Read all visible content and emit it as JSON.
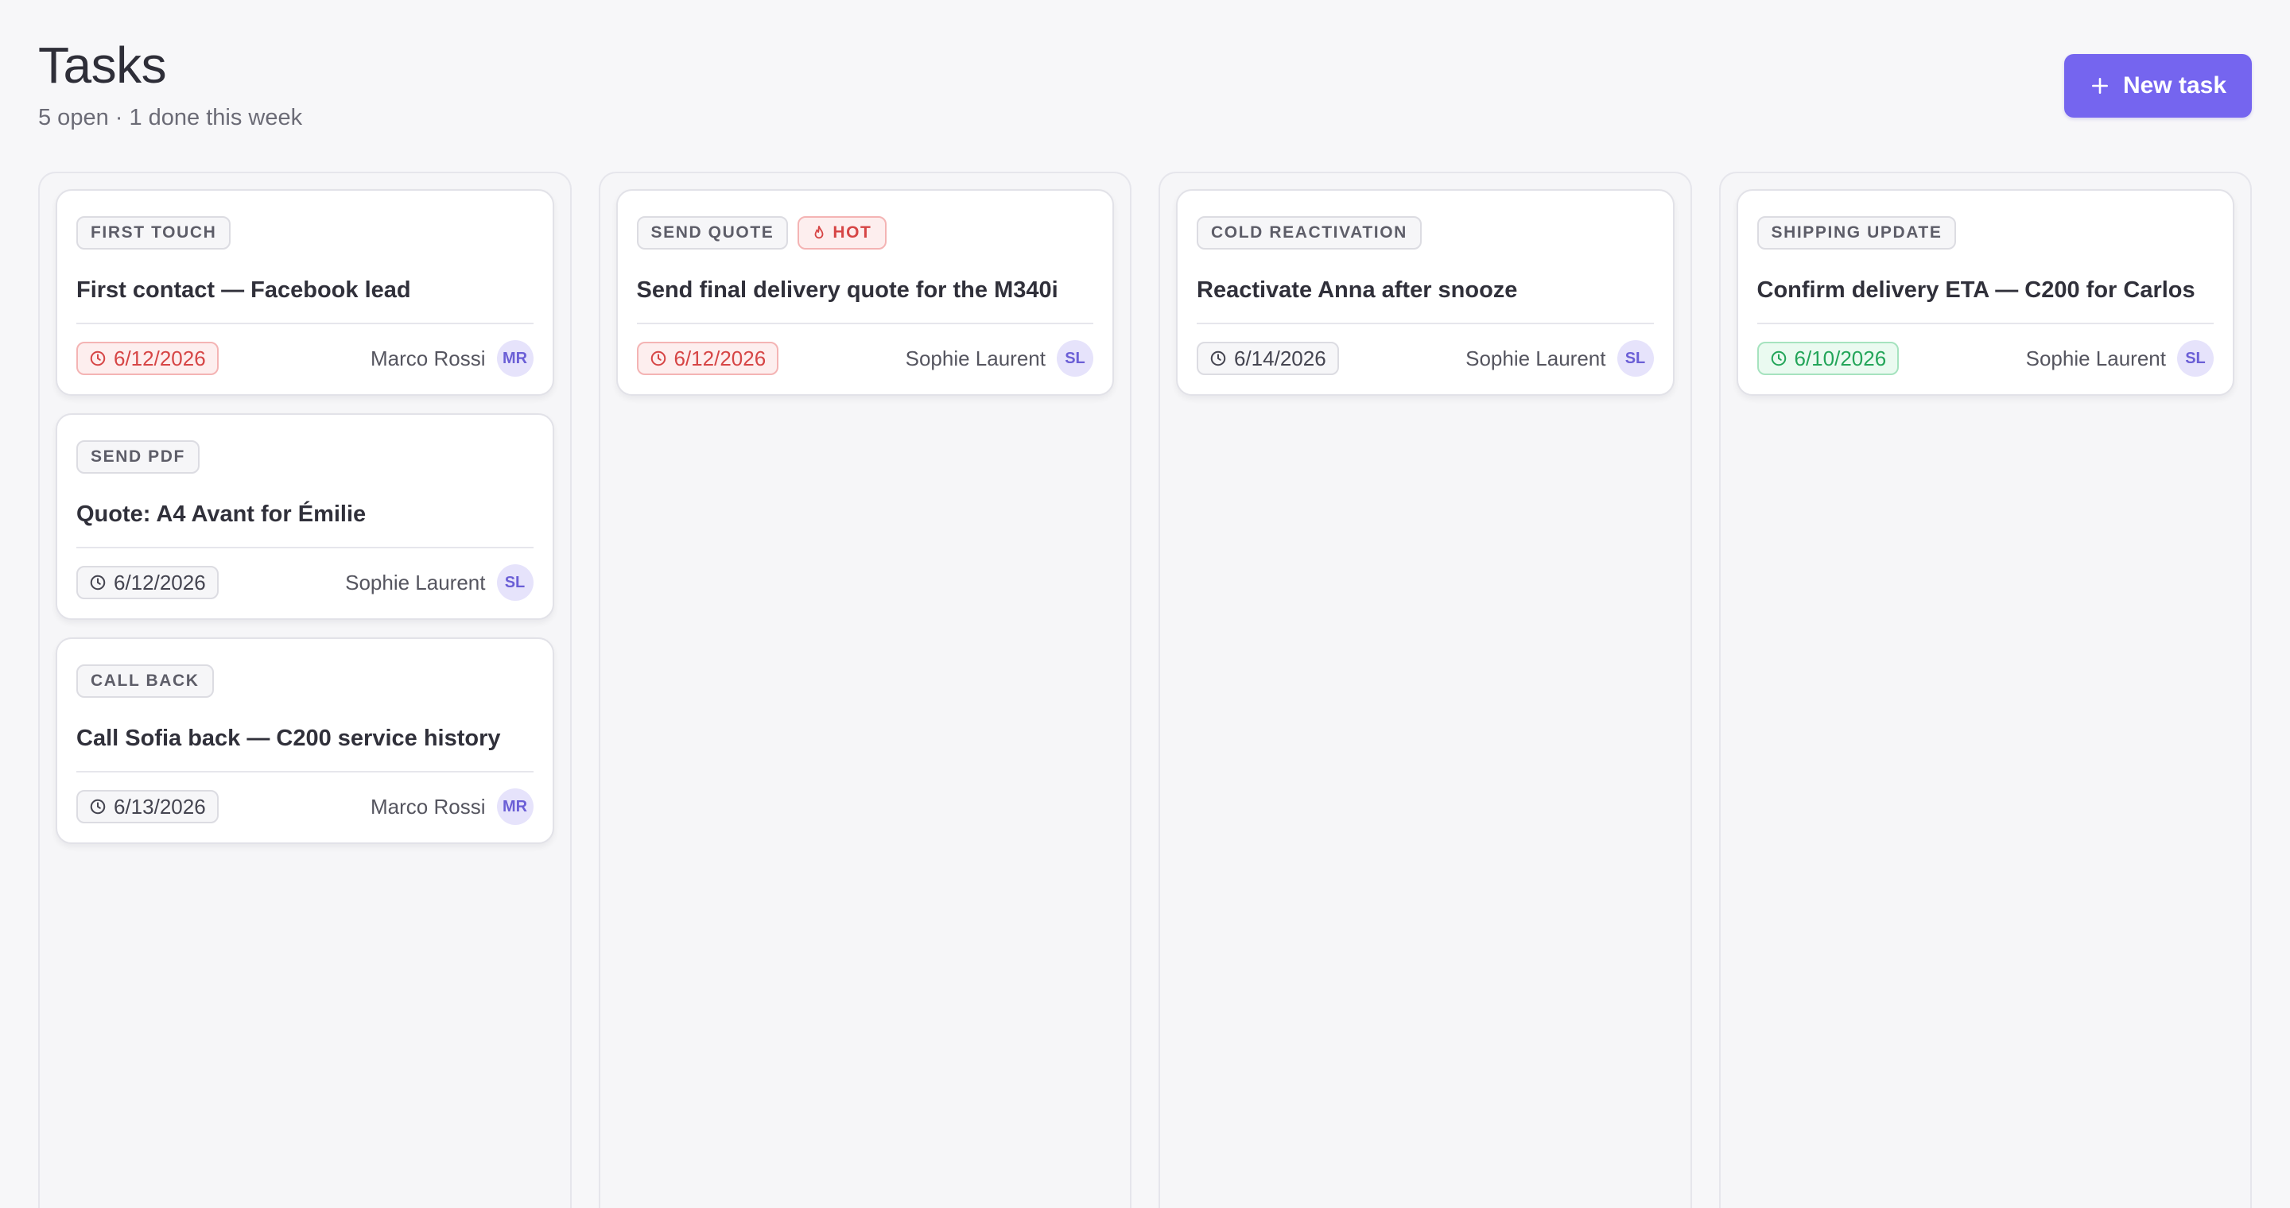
{
  "header": {
    "title": "Tasks",
    "subtitle": "5 open · 1 done this week",
    "new_task_label": "New task"
  },
  "colors": {
    "accent": "#7565ef",
    "overdue": "#d64545",
    "on_time": "#23a559",
    "avatar_bg": "#e6e3fb"
  },
  "columns": [
    {
      "cards": [
        {
          "tags": [
            "FIRST TOUCH"
          ],
          "title": "First contact — Facebook lead",
          "due": "6/12/2026",
          "due_status": "overdue",
          "assignee": "Marco Rossi",
          "initials": "MR"
        },
        {
          "tags": [
            "SEND PDF"
          ],
          "title": "Quote: A4 Avant for Émilie",
          "due": "6/12/2026",
          "due_status": "normal",
          "assignee": "Sophie Laurent",
          "initials": "SL"
        },
        {
          "tags": [
            "CALL BACK"
          ],
          "title": "Call Sofia back — C200 service history",
          "due": "6/13/2026",
          "due_status": "normal",
          "assignee": "Marco Rossi",
          "initials": "MR"
        }
      ]
    },
    {
      "cards": [
        {
          "tags": [
            "SEND QUOTE"
          ],
          "hot_label": "HOT",
          "title": "Send final delivery quote for the M340i",
          "due": "6/12/2026",
          "due_status": "overdue",
          "assignee": "Sophie Laurent",
          "initials": "SL"
        }
      ]
    },
    {
      "cards": [
        {
          "tags": [
            "COLD REACTIVATION"
          ],
          "title": "Reactivate Anna after snooze",
          "due": "6/14/2026",
          "due_status": "normal",
          "assignee": "Sophie Laurent",
          "initials": "SL"
        }
      ]
    },
    {
      "cards": [
        {
          "tags": [
            "SHIPPING UPDATE"
          ],
          "title": "Confirm delivery ETA — C200 for Carlos",
          "due": "6/10/2026",
          "due_status": "soon",
          "assignee": "Sophie Laurent",
          "initials": "SL"
        }
      ]
    }
  ]
}
